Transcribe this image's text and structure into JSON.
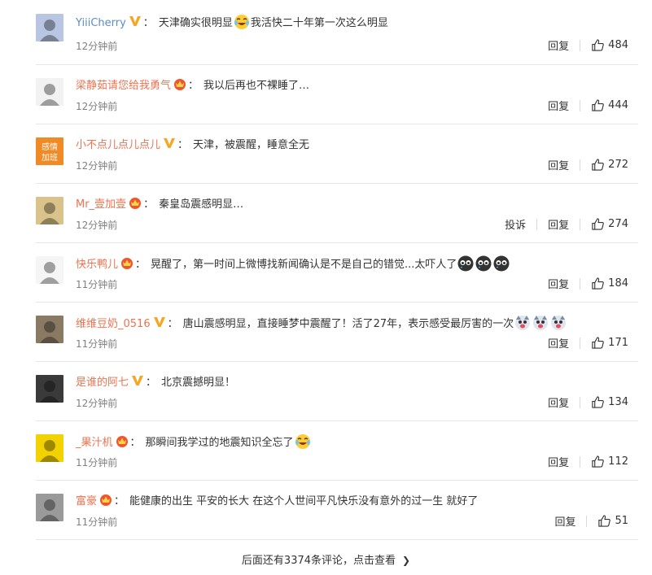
{
  "comments": [
    {
      "user": "YiiiCherry",
      "badge": "gold-v",
      "text": "天津确实很明显",
      "emojis_after_text": [
        "laugh-cry"
      ],
      "text2": "我活快二十年第一次这么明显",
      "time": "12分钟前",
      "report": "",
      "reply": "回复",
      "likes": "484",
      "avatar_color": "#b9c6e3"
    },
    {
      "user": "梁静茹请您给我勇气",
      "badge": "crown",
      "text": "我以后再也不裸睡了…",
      "time": "12分钟前",
      "report": "",
      "reply": "回复",
      "likes": "444",
      "avatar_color": "#f2f2f2"
    },
    {
      "user": "小不点儿点儿点儿",
      "badge": "gold-v",
      "text": "天津，被震醒，睡意全无",
      "time": "12分钟前",
      "report": "",
      "reply": "回复",
      "likes": "272",
      "avatar_color": "#f08a24",
      "avatar_text": "感情加班"
    },
    {
      "user": "Mr_壹加壹",
      "badge": "crown",
      "text": "秦皇岛震感明显…",
      "time": "12分钟前",
      "report": "投诉",
      "reply": "回复",
      "likes": "274",
      "avatar_color": "#d9c38a"
    },
    {
      "user": "快乐鸭儿",
      "badge": "crown",
      "text": "晃醒了，第一时间上微博找新闻确认是不是自己的错觉...太吓人了",
      "emojis_after_text": [
        "scared",
        "scared",
        "scared"
      ],
      "time": "11分钟前",
      "report": "",
      "reply": "回复",
      "likes": "184",
      "avatar_color": "#f5f5f5"
    },
    {
      "user": "维维豆奶_0516",
      "badge": "gold-v",
      "text": "唐山震感明显，直接睡梦中震醒了！活了27年，表示感受最厉害的一次",
      "emojis_after_text": [
        "husky",
        "husky",
        "husky"
      ],
      "time": "11分钟前",
      "report": "",
      "reply": "回复",
      "likes": "171",
      "avatar_color": "#8a7a63"
    },
    {
      "user": "是谁的阿七",
      "badge": "gold-v",
      "text": "北京震撼明显！",
      "time": "12分钟前",
      "report": "",
      "reply": "回复",
      "likes": "134",
      "avatar_color": "#3a3a3a"
    },
    {
      "user": "_果汁机",
      "badge": "crown",
      "text": "那瞬间我学过的地震知识全忘了",
      "emojis_after_text": [
        "laugh-cry"
      ],
      "time": "11分钟前",
      "report": "",
      "reply": "回复",
      "likes": "112",
      "avatar_color": "#f2d200"
    },
    {
      "user": "富豪",
      "badge": "crown",
      "text": "能健康的出生 平安的长大 在这个人世间平凡快乐没有意外的过一生 就好了",
      "time": "11分钟前",
      "report": "",
      "reply": "回复",
      "likes": "51",
      "avatar_color": "#9a9a9a"
    }
  ],
  "more_comments": "后面还有3374条评论，点击查看",
  "colors": {
    "username": "#eb7350",
    "gold": "#f5a623",
    "crown": "#f0552b"
  }
}
